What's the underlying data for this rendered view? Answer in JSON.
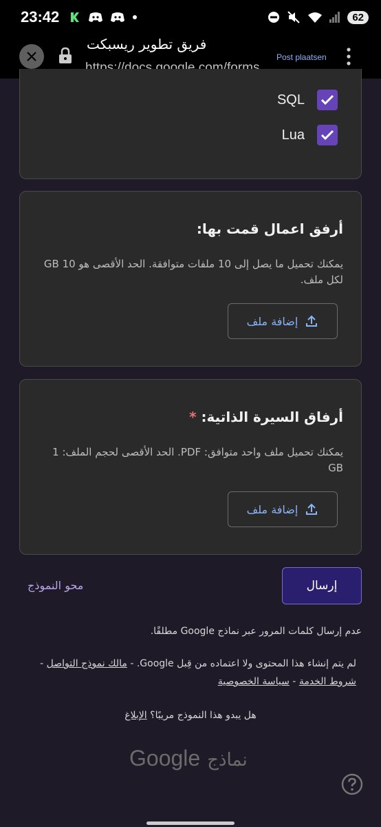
{
  "status": {
    "time": "23:42",
    "battery": "62"
  },
  "browser": {
    "title": "فريق تطوير ريسبكت",
    "url": "https://docs.google.com/forms",
    "post_label": "Post plaatsen"
  },
  "checkboxes": [
    {
      "label": "SQL",
      "checked": true
    },
    {
      "label": "Lua",
      "checked": true
    }
  ],
  "question_works": {
    "title": "أرفق اعمال قمت بها:",
    "description": "يمكنك تحميل ما يصل إلى 10 ملفات متوافقة. الحد الأقصى هو 10 GB لكل ملف.",
    "button": "إضافة ملف"
  },
  "question_cv": {
    "title": "أرفاق السيرة الذاتية:",
    "required_mark": "*",
    "description": "يمكنك تحميل ملف واحد متوافق: PDF. الحد الأقصى لحجم الملف: 1 GB",
    "button": "إضافة ملف"
  },
  "submit_label": "إرسال",
  "clear_label": "محو النموذج",
  "footer": {
    "passwords": "عدم إرسال كلمات المرور عبر نماذج Google مطلقًا.",
    "disclaimer": "لم يتم إنشاء هذا المحتوى ولا اعتماده من قِبل Google. -",
    "contact_owner": "مالك نموذج التواصل",
    "terms": "شروط الخدمة",
    "privacy": "سياسة الخصوصية",
    "suspicious": "هل يبدو هذا النموذج مريبًا؟",
    "report": "الإبلاغ",
    "brand_google": "Google",
    "brand_forms": "نماذج"
  },
  "colors": {
    "accent": "#6743b8",
    "link": "#8ab4f8",
    "submit_bg": "#2a1f6e",
    "required": "#e57373"
  }
}
